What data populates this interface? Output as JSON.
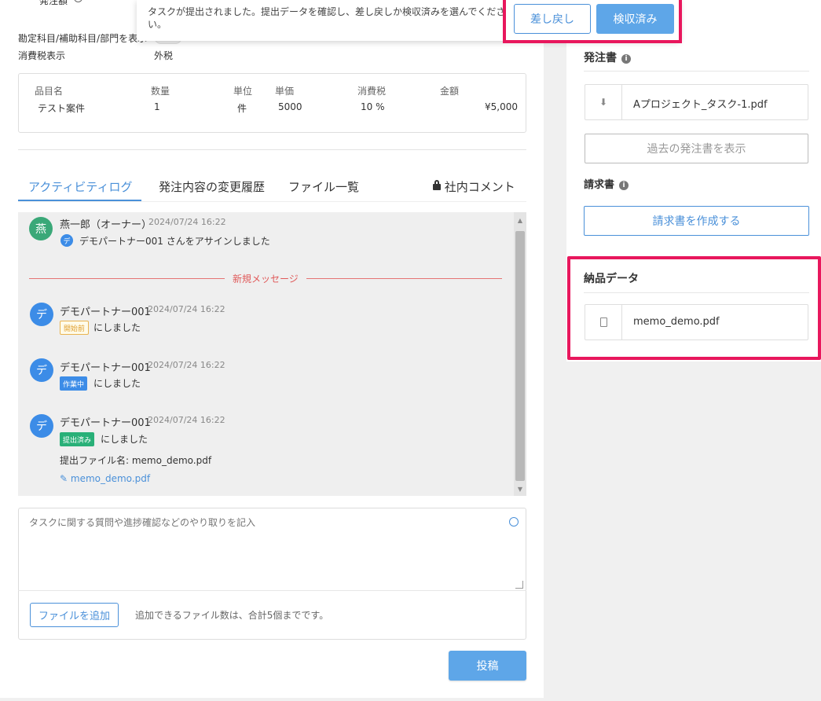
{
  "notice": {
    "text": "タスクが提出されました。提出データを確認し、差し戻しか検収済みを選んでください。",
    "reject_label": "差し戻し",
    "accept_label": "検収済み"
  },
  "info": {
    "top_label": "発注額",
    "account_label": "勘定科目/補助科目/部門を表示",
    "tax_label": "消費税表示",
    "tax_value": "外税"
  },
  "items_table": {
    "headers": [
      "品目名",
      "数量",
      "単位",
      "単価",
      "消費税",
      "金額"
    ],
    "rows": [
      [
        "テスト案件",
        "1",
        "件",
        "5000",
        "10 %",
        "¥5,000"
      ]
    ]
  },
  "tabs": {
    "activity": "アクティビティログ",
    "history": "発注内容の変更履歴",
    "files": "ファイル一覧",
    "internal": "社内コメント"
  },
  "log": {
    "entries": [
      {
        "avatar": "燕",
        "name": "燕一郎（オーナー）",
        "time": "2024/07/24 16:22",
        "mini_avatar": "デ",
        "message": "デモパートナー001 さんをアサインしました"
      },
      {
        "avatar": "デ",
        "name": "デモパートナー001",
        "time": "2024/07/24 16:22",
        "badge": "開始前",
        "message": "にしました"
      },
      {
        "avatar": "デ",
        "name": "デモパートナー001",
        "time": "2024/07/24 16:22",
        "badge": "作業中",
        "message": "にしました"
      },
      {
        "avatar": "デ",
        "name": "デモパートナー001",
        "time": "2024/07/24 16:22",
        "badge": "提出済み",
        "message": "にしました",
        "file_line": "提出ファイル名: memo_demo.pdf",
        "attachment": "memo_demo.pdf"
      }
    ],
    "new_message_label": "新規メッセージ"
  },
  "comment": {
    "placeholder": "タスクに関する質問や進捗確認などのやり取りを記入",
    "add_file_label": "ファイルを追加",
    "file_limit_note": "追加できるファイル数は、合計5個までです。",
    "post_label": "投稿"
  },
  "right": {
    "purchase_order_title": "発注書",
    "purchase_order_file": "Aプロジェクト_タスク-1.pdf",
    "past_orders_label": "過去の発注書を表示",
    "invoice_title": "請求書",
    "create_invoice_label": "請求書を作成する",
    "delivery_title": "納品データ",
    "delivery_file": "memo_demo.pdf"
  },
  "colors": {
    "accent": "#4a90d9",
    "highlight": "#e8175d",
    "badge_pending": "#e9b450",
    "badge_working": "#3c8ce7",
    "badge_submitted": "#29b078"
  }
}
